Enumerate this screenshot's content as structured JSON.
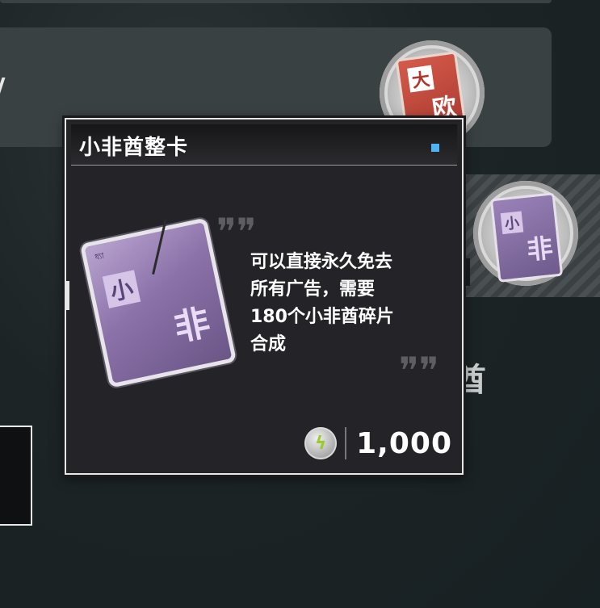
{
  "background": {
    "red_card": {
      "char1": "大",
      "char2": "欧"
    },
    "purple_card": {
      "char1": "小",
      "char2": "非"
    },
    "partial_char": "酋"
  },
  "tooltip": {
    "title": "小非酋整卡",
    "indicator_color": "#4fb3f2",
    "card": {
      "small_text": "ধ্যা",
      "char1": "小",
      "char2": "非"
    },
    "description": [
      "可以直接永久免去",
      "所有广告，需要",
      "180个小非酋碎片",
      "合成"
    ],
    "price": {
      "currency_icon": "lightning-coin-icon",
      "amount": "1,000"
    }
  }
}
